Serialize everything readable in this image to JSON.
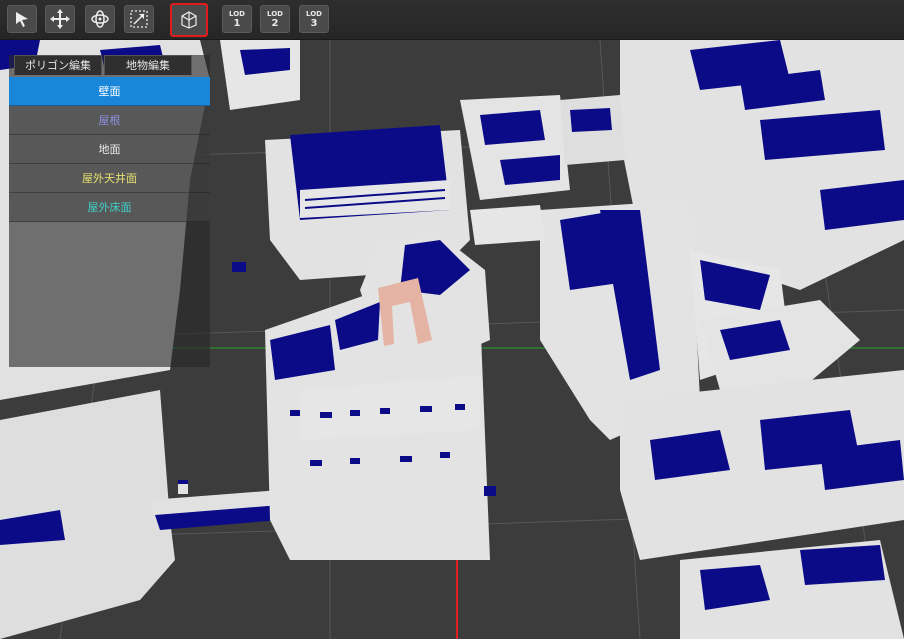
{
  "toolbar": {
    "tools": [
      {
        "icon": "select-arrow-icon"
      },
      {
        "icon": "move-icon"
      },
      {
        "icon": "rotate-icon"
      },
      {
        "icon": "scale-icon"
      },
      {
        "icon": "building-view-icon",
        "active": true
      }
    ],
    "lod": [
      {
        "top": "LOD",
        "num": "1"
      },
      {
        "top": "LOD",
        "num": "2"
      },
      {
        "top": "LOD",
        "num": "3"
      }
    ]
  },
  "panel": {
    "tabs": [
      "ポリゴン編集",
      "地物編集"
    ],
    "items": [
      {
        "label": "壁面",
        "color": "#ffffff"
      },
      {
        "label": "屋根",
        "color": "#8f8fe0"
      },
      {
        "label": "地面",
        "color": "#e8e8e8"
      },
      {
        "label": "屋外天井面",
        "color": "#e8e070"
      },
      {
        "label": "屋外床面",
        "color": "#3fd0c8"
      }
    ]
  },
  "colors": {
    "wall": "#e3e3e3",
    "roof": "#0b0b87",
    "ground": "#3c3c3c",
    "highlight": "#e4b3a3",
    "selection": "#1a86d9"
  }
}
